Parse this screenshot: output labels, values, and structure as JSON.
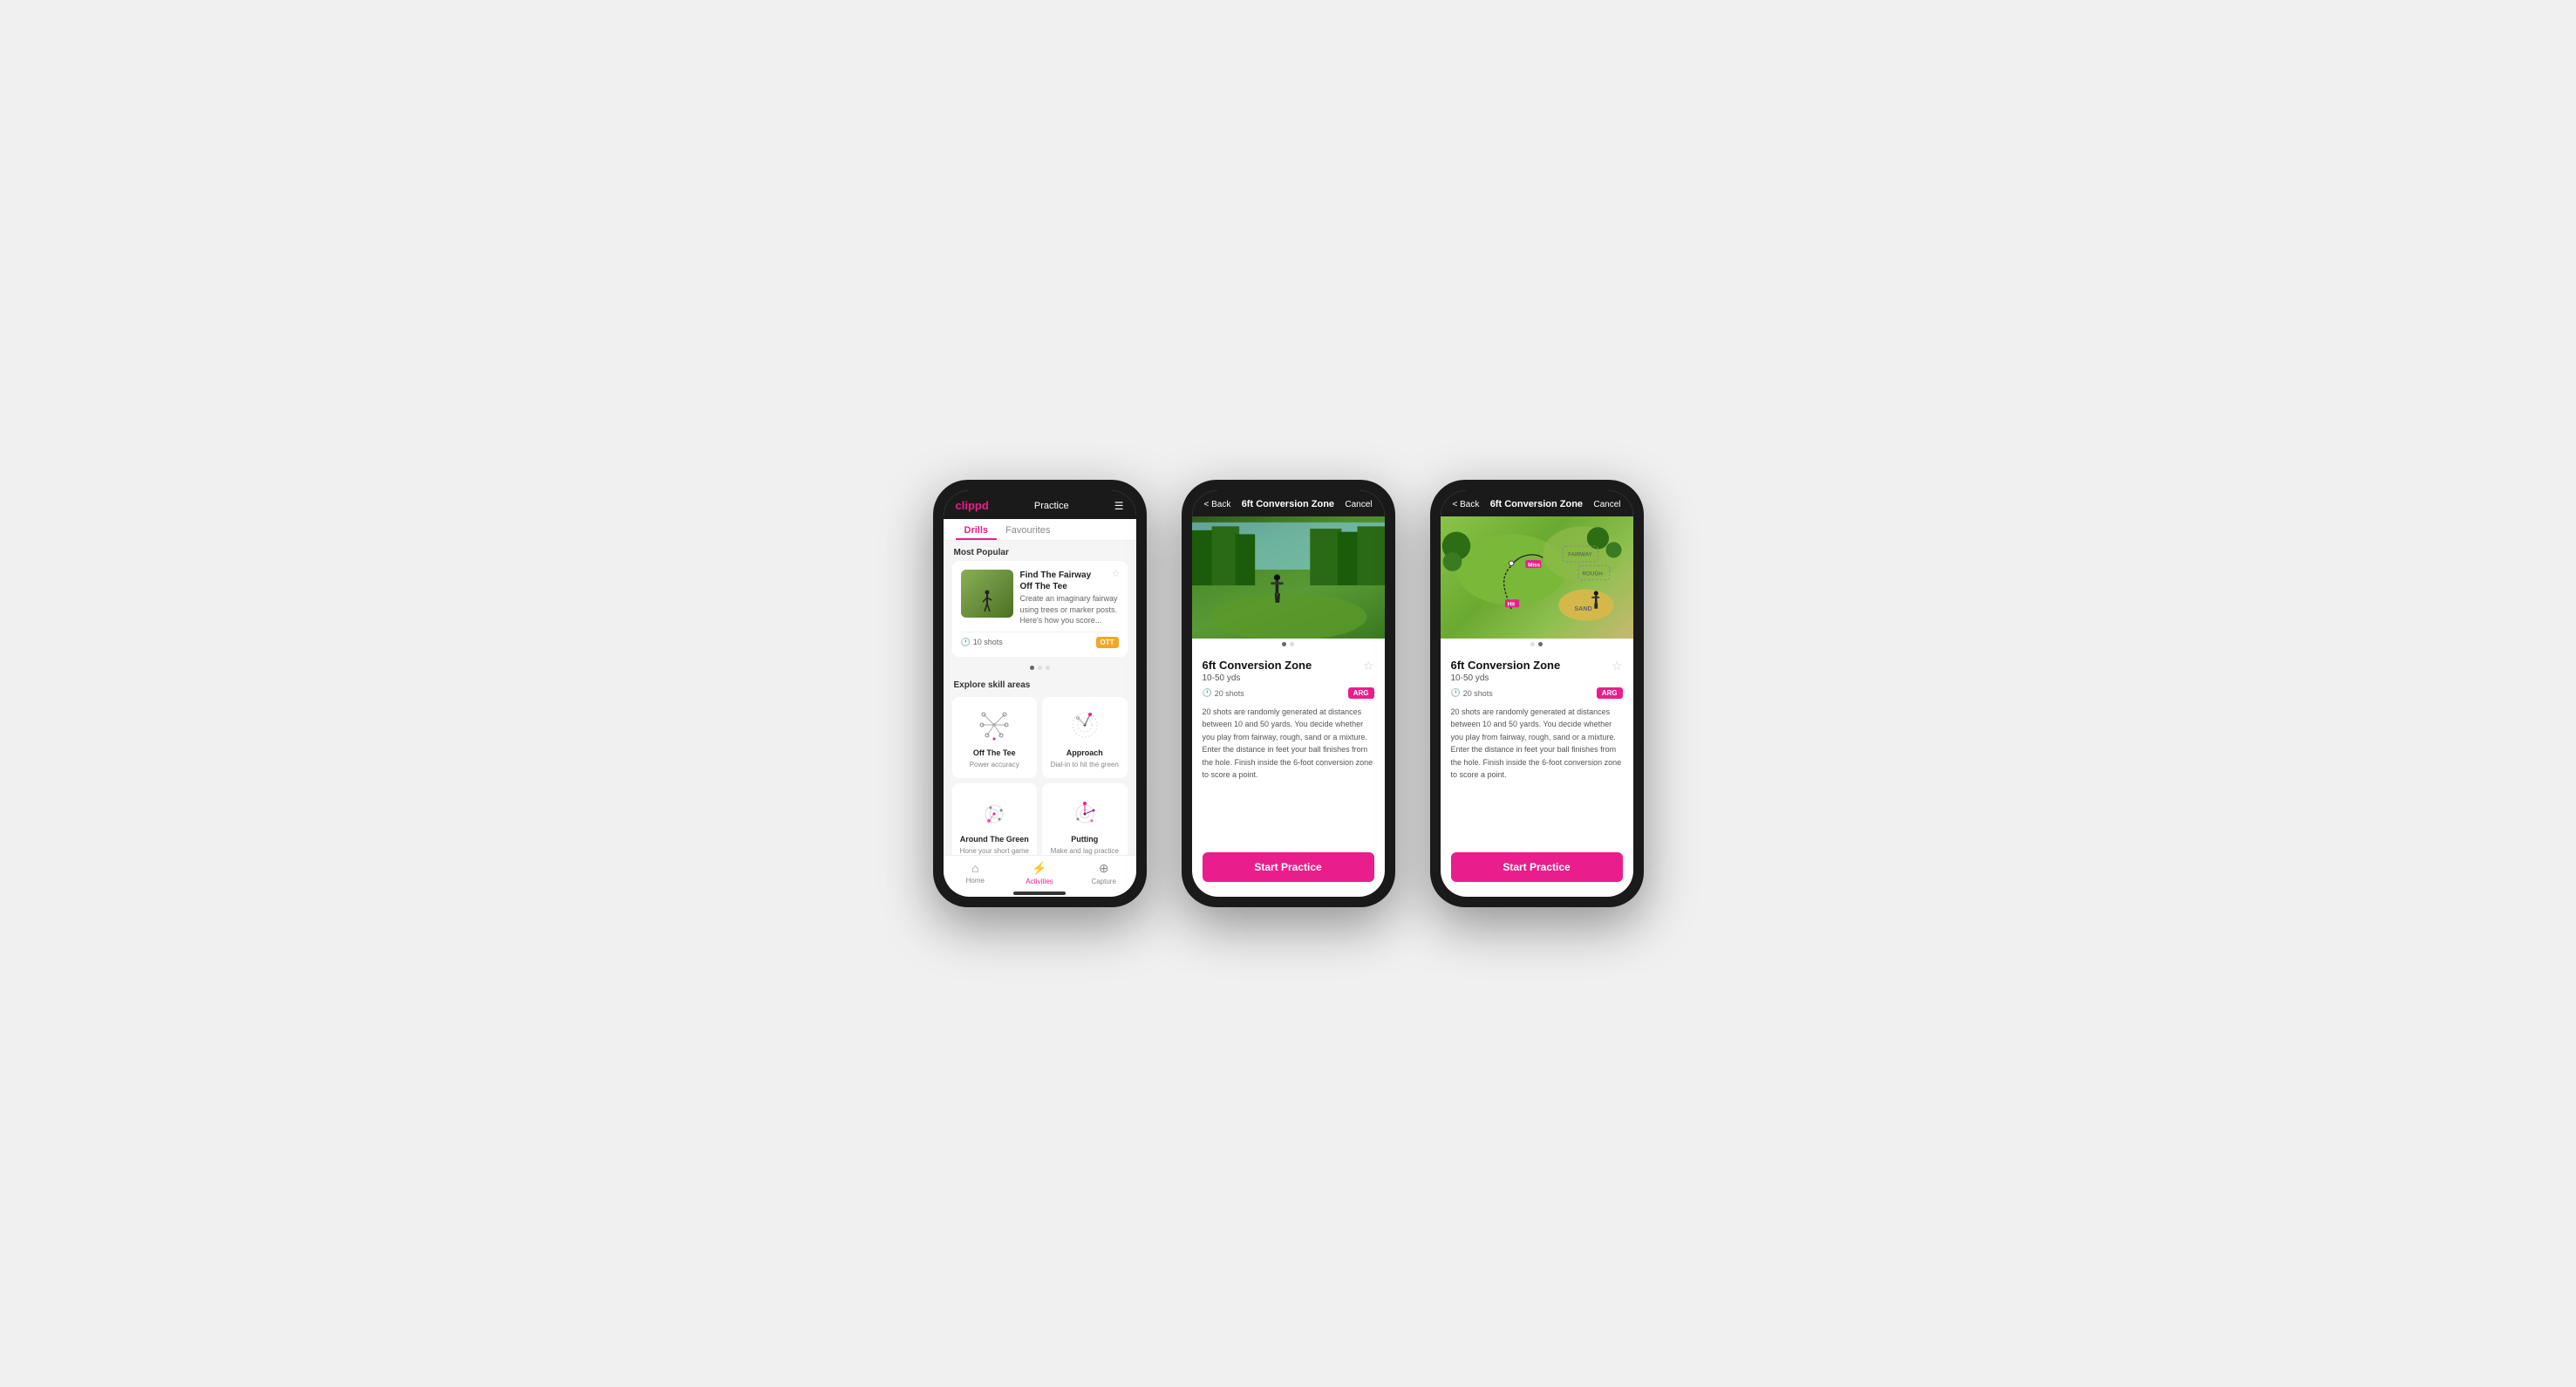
{
  "phone1": {
    "header": {
      "logo": "clippd",
      "nav_title": "Practice",
      "menu_icon": "☰"
    },
    "tabs": [
      {
        "label": "Drills",
        "active": true
      },
      {
        "label": "Favourites",
        "active": false
      }
    ],
    "most_popular_label": "Most Popular",
    "featured_drill": {
      "title": "Find The Fairway",
      "subtitle": "Off The Tee",
      "description": "Create an imaginary fairway using trees or marker posts. Here's how you score...",
      "shots": "10 shots",
      "badge": "OTT"
    },
    "explore_label": "Explore skill areas",
    "skill_areas": [
      {
        "name": "Off The Tee",
        "desc": "Power accuracy"
      },
      {
        "name": "Approach",
        "desc": "Dial-in to hit the green"
      },
      {
        "name": "Around The Green",
        "desc": "Hone your short game"
      },
      {
        "name": "Putting",
        "desc": "Make and lag practice"
      }
    ],
    "bottom_nav": [
      {
        "label": "Home",
        "icon": "⌂",
        "active": false
      },
      {
        "label": "Activities",
        "icon": "⚡",
        "active": true
      },
      {
        "label": "Capture",
        "icon": "+",
        "active": false
      }
    ]
  },
  "phone2": {
    "header": {
      "back_label": "< Back",
      "title": "6ft Conversion Zone",
      "cancel_label": "Cancel"
    },
    "drill": {
      "title": "6ft Conversion Zone",
      "range": "10-50 yds",
      "shots": "20 shots",
      "badge": "ARG",
      "description": "20 shots are randomly generated at distances between 10 and 50 yards. You decide whether you play from fairway, rough, sand or a mixture. Enter the distance in feet your ball finishes from the hole. Finish inside the 6-foot conversion zone to score a point.",
      "fav_icon": "☆"
    },
    "start_btn_label": "Start Practice"
  },
  "phone3": {
    "header": {
      "back_label": "< Back",
      "title": "6ft Conversion Zone",
      "cancel_label": "Cancel"
    },
    "drill": {
      "title": "6ft Conversion Zone",
      "range": "10-50 yds",
      "shots": "20 shots",
      "badge": "ARG",
      "description": "20 shots are randomly generated at distances between 10 and 50 yards. You decide whether you play from fairway, rough, sand or a mixture. Enter the distance in feet your ball finishes from the hole. Finish inside the 6-foot conversion zone to score a point.",
      "fav_icon": "☆"
    },
    "start_btn_label": "Start Practice"
  }
}
